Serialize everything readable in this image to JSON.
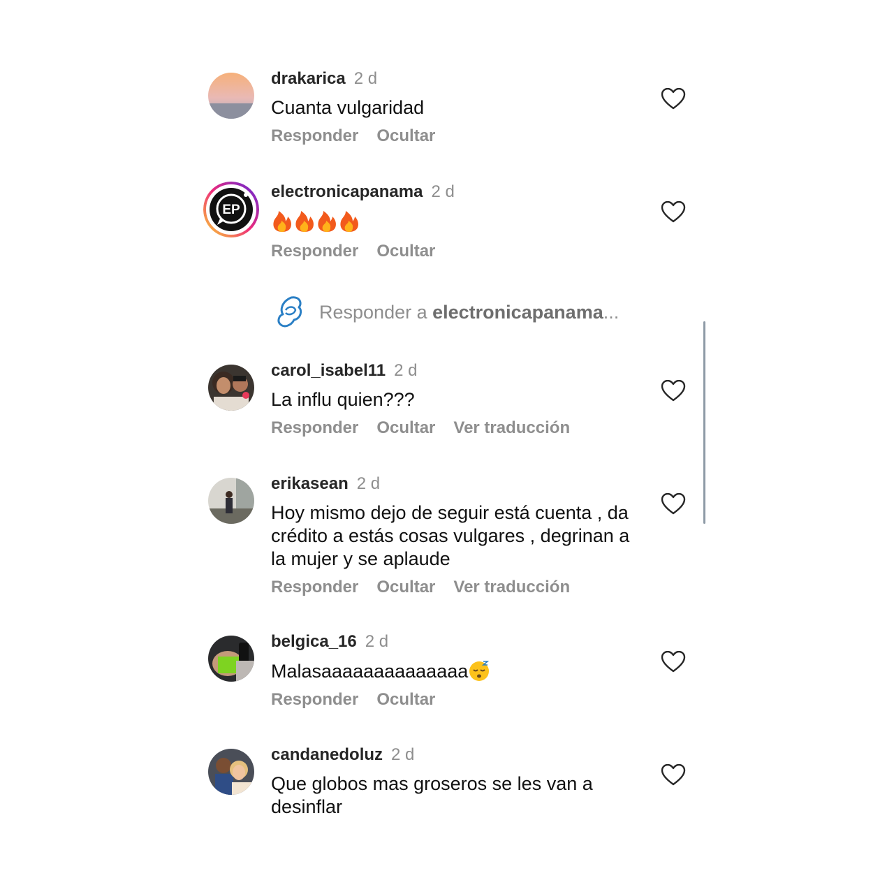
{
  "comments": [
    {
      "user": "drakarica",
      "time": "2 d",
      "text": "Cuanta vulgaridad",
      "actions": [
        "Responder",
        "Ocultar"
      ]
    },
    {
      "user": "electronicapanama",
      "time": "2 d",
      "text": "",
      "actions": [
        "Responder",
        "Ocultar"
      ],
      "emoji_count": 4
    },
    {
      "user": "carol_isabel11",
      "time": "2 d",
      "text": "La influ quien???",
      "actions": [
        "Responder",
        "Ocultar",
        "Ver traducción"
      ]
    },
    {
      "user": "erikasean",
      "time": "2 d",
      "text": "Hoy mismo dejo de seguir está cuenta , da crédito a estás cosas  vulgares , degrinan a la mujer y se aplaude",
      "actions": [
        "Responder",
        "Ocultar",
        "Ver traducción"
      ]
    },
    {
      "user": "belgica_16",
      "time": "2 d",
      "text": "Malasaaaaaaaaaaaaaa",
      "actions": [
        "Responder",
        "Ocultar"
      ]
    },
    {
      "user": "candanedoluz",
      "time": "2 d",
      "text": "Que globos mas groseros se les van a desinflar",
      "actions": []
    }
  ],
  "avatar_logo_text": "EP",
  "reply_prompt": {
    "prefix": "Responder a ",
    "target": "electronicapanama",
    "suffix": "..."
  },
  "colors": {
    "muted": "#8e8e8e",
    "username": "#262626",
    "brand_ring": "#f58529"
  },
  "icons": {
    "like": "heart-outline-icon",
    "reply": "reply-logo-icon",
    "fire": "fire-emoji-icon",
    "sleepy": "sleepy-face-emoji-icon"
  }
}
